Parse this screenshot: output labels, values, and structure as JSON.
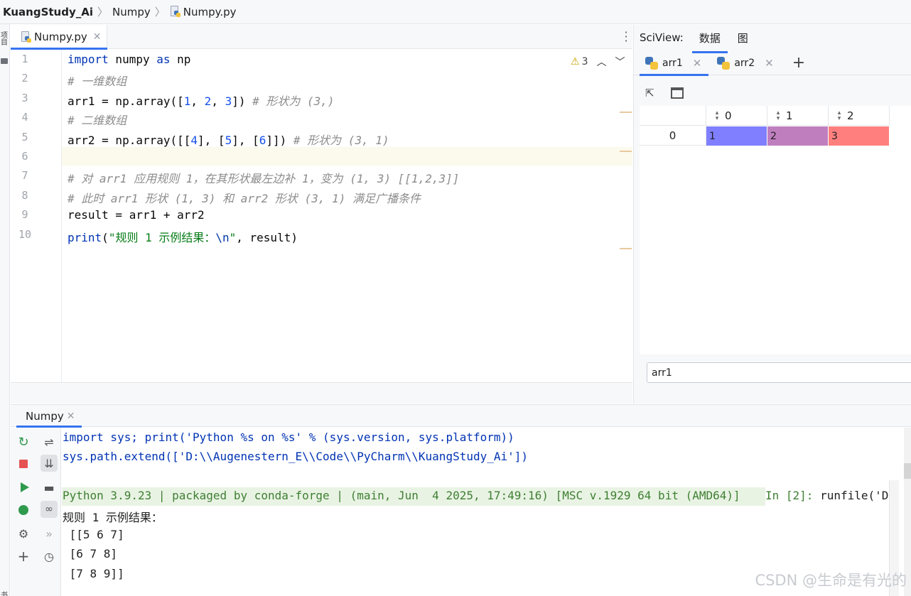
{
  "breadcrumb": {
    "project": "KuangStudy_Ai",
    "folder": "Numpy",
    "file": "Numpy.py"
  },
  "left_stripe": {
    "top_label": "项目",
    "bottom_label": "书签"
  },
  "editor": {
    "tab_label": "Numpy.py",
    "warning_count": "3",
    "line_numbers": [
      "1",
      "2",
      "3",
      "4",
      "5",
      "6",
      "7",
      "8",
      "9",
      "10"
    ]
  },
  "code_lines": [
    [
      {
        "t": "import",
        "c": "kw"
      },
      {
        "t": " numpy ",
        "c": ""
      },
      {
        "t": "as",
        "c": "kw"
      },
      {
        "t": " np",
        "c": ""
      }
    ],
    [
      {
        "t": "# 一维数组",
        "c": "cmt"
      }
    ],
    [
      {
        "t": "arr1 = np.array([",
        "c": ""
      },
      {
        "t": "1",
        "c": "num"
      },
      {
        "t": ", ",
        "c": ""
      },
      {
        "t": "2",
        "c": "num"
      },
      {
        "t": ", ",
        "c": ""
      },
      {
        "t": "3",
        "c": "num"
      },
      {
        "t": "]) ",
        "c": ""
      },
      {
        "t": "# 形状为 (3,)",
        "c": "cmt"
      }
    ],
    [
      {
        "t": "# 二维数组",
        "c": "cmt"
      }
    ],
    [
      {
        "t": "arr2 = np.array([[",
        "c": ""
      },
      {
        "t": "4",
        "c": "num"
      },
      {
        "t": "], [",
        "c": ""
      },
      {
        "t": "5",
        "c": "num"
      },
      {
        "t": "], [",
        "c": ""
      },
      {
        "t": "6",
        "c": "num"
      },
      {
        "t": "]]) ",
        "c": ""
      },
      {
        "t": "# 形状为 (3, 1)",
        "c": "cmt"
      }
    ],
    [],
    [
      {
        "t": "# 对 arr1 应用规则 1，在其形状最左边补 1，变为 (1, 3) [[1,2,3]]",
        "c": "cmt"
      }
    ],
    [
      {
        "t": "# 此时 arr1 形状 (1, 3) 和 arr2 形状 (3, 1) 满足广播条件",
        "c": "cmt"
      }
    ],
    [
      {
        "t": "result = arr1 + arr2",
        "c": ""
      }
    ],
    [
      {
        "t": "print",
        "c": "kw"
      },
      {
        "t": "(",
        "c": ""
      },
      {
        "t": "\"规则 1 示例结果：",
        "c": "str"
      },
      {
        "t": "\\n",
        "c": "esc"
      },
      {
        "t": "\"",
        "c": "str"
      },
      {
        "t": ", result)",
        "c": ""
      }
    ]
  ],
  "sciview": {
    "title": "SciView:",
    "tabs": [
      "数据",
      "图"
    ],
    "active_tab": "数据",
    "array_tabs": [
      "arr1",
      "arr2"
    ],
    "active_array": "arr1",
    "grid": {
      "columns": [
        "0",
        "1",
        "2"
      ],
      "rows": [
        {
          "index": "0",
          "values": [
            "1",
            "2",
            "3"
          ],
          "colors": [
            "#7f7fff",
            "#bf7fbf",
            "#ff7f7f"
          ]
        }
      ]
    },
    "input_value": "arr1"
  },
  "console": {
    "tab_label": "Numpy",
    "lines": [
      {
        "text": "import sys; print('Python %s on %s' % (sys.version, sys.platform))",
        "style": "cblue"
      },
      {
        "text": "sys.path.extend(['D:\\\\Augenestern_E\\\\Code\\\\PyCharm\\\\KuangStudy_Ai'])",
        "style": "cblue"
      },
      {
        "text": "",
        "style": "cblack"
      },
      {
        "text": "Python 3.9.23 | packaged by conda-forge | (main, Jun  4 2025, 17:49:16) [MSC v.1929 64 bit (AMD64)]",
        "style": "cgreen"
      },
      {
        "text": "规则 1 示例结果：",
        "style": "cblack"
      },
      {
        "text": " [[5 6 7]",
        "style": "cblack"
      },
      {
        "text": " [6 7 8]",
        "style": "cblack"
      },
      {
        "text": " [7 8 9]]",
        "style": "cblack"
      }
    ],
    "prompt": "In [2]:",
    "command": " runfile('D:"
  },
  "watermark": "CSDN @生命是有光的",
  "colors": {
    "accent": "#3574f0",
    "keyword": "#0033b3",
    "number": "#1750eb",
    "comment": "#8c8c8c",
    "string": "#067d17"
  }
}
